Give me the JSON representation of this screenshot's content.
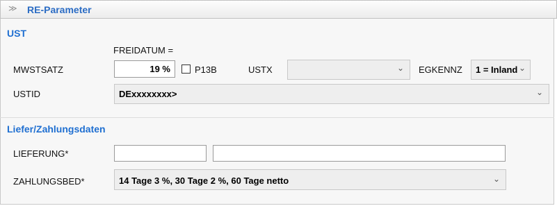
{
  "header": {
    "title": "RE-Parameter",
    "collapse_icon": "double-chevron-up-icon"
  },
  "ust": {
    "section_title": "UST",
    "freidatum_label": "FREIDATUM =",
    "mwstsatz_label": "MWSTSATZ",
    "mwstsatz_value": "19 %",
    "p13b_label": "P13B",
    "p13b_checked": false,
    "ustx_label": "USTX",
    "ustx_value": "",
    "egkennz_label": "EGKENNZ",
    "egkennz_value": "1 = Inland",
    "ustid_label": "USTID",
    "ustid_value": "DExxxxxxxx>"
  },
  "liefer": {
    "section_title": "Liefer/Zahlungsdaten",
    "lieferung_label": "LIEFERUNG*",
    "lieferung_value1": "",
    "lieferung_value2": "",
    "zahlungsbed_label": "ZAHLUNGSBED*",
    "zahlungsbed_value": "14 Tage 3 %, 30 Tage 2 %, 60 Tage netto"
  },
  "icons": {
    "dropdown": "chevron-down-icon"
  }
}
